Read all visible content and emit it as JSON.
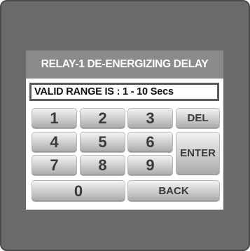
{
  "dialog": {
    "title": "RELAY-1 DE-ENERGIZING DELAY",
    "range_text": "VALID RANGE IS : 1 - 10 Secs"
  },
  "keypad": {
    "digits": [
      "1",
      "2",
      "3",
      "4",
      "5",
      "6",
      "7",
      "8",
      "9",
      "0"
    ],
    "del_label": "DEL",
    "enter_label": "ENTER",
    "back_label": "BACK"
  },
  "colors": {
    "bezel": "#6a6a6a",
    "title_bar": "#8b8b8b",
    "screen": "#ffffff"
  }
}
